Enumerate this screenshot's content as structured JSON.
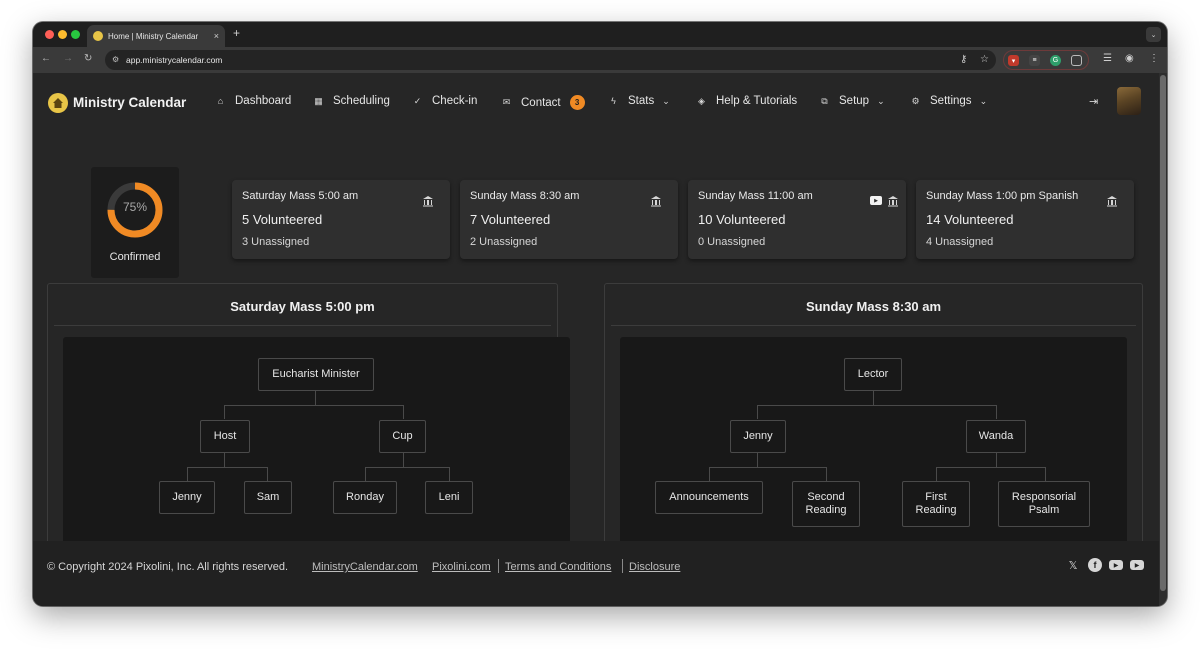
{
  "browser": {
    "tab_title": "Home | Ministry Calendar",
    "tab_close": "×",
    "new_tab": "+",
    "url": "app.ministrycalendar.com"
  },
  "app": {
    "brand": "Ministry Calendar",
    "nav": [
      {
        "label": "Dashboard",
        "icon": "home-icon"
      },
      {
        "label": "Scheduling",
        "icon": "calendar-icon"
      },
      {
        "label": "Check-in",
        "icon": "check-circle-icon"
      },
      {
        "label": "Contact",
        "icon": "envelope-icon",
        "badge": "3"
      },
      {
        "label": "Stats",
        "icon": "bolt-icon",
        "dropdown": true
      },
      {
        "label": "Help & Tutorials",
        "icon": "graduation-cap-icon"
      },
      {
        "label": "Setup",
        "icon": "sitemap-icon",
        "dropdown": true
      },
      {
        "label": "Settings",
        "icon": "gear-icon",
        "dropdown": true
      }
    ]
  },
  "summary": {
    "confirmed_percent": 75,
    "confirmed_text": "75%",
    "confirmed_label": "Confirmed"
  },
  "masses": [
    {
      "title": "Saturday Mass 5:00 am",
      "volunteered": "5 Volunteered",
      "unassigned": "3 Unassigned",
      "youtube": false
    },
    {
      "title": "Sunday Mass 8:30 am",
      "volunteered": "7 Volunteered",
      "unassigned": "2 Unassigned",
      "youtube": false
    },
    {
      "title": "Sunday Mass 11:00 am",
      "volunteered": "10 Volunteered",
      "unassigned": "0 Unassigned",
      "youtube": true
    },
    {
      "title": "Sunday Mass 1:00 pm Spanish",
      "volunteered": "14 Volunteered",
      "unassigned": "4 Unassigned",
      "youtube": false
    }
  ],
  "panels": [
    {
      "title": "Saturday Mass 5:00 pm",
      "root": "Eucharist Minister",
      "children": [
        {
          "label": "Host",
          "children": [
            "Jenny",
            "Sam"
          ]
        },
        {
          "label": "Cup",
          "children": [
            "Ronday",
            "Leni"
          ]
        }
      ]
    },
    {
      "title": "Sunday Mass 8:30 am",
      "root": "Lector",
      "children": [
        {
          "label": "Jenny",
          "children": [
            "Announcements",
            "Second Reading"
          ]
        },
        {
          "label": "Wanda",
          "children": [
            "First Reading",
            "Responsorial Psalm"
          ]
        }
      ]
    }
  ],
  "footer": {
    "copyright": "© Copyright 2024 Pixolini, Inc. All rights reserved.",
    "links": [
      "MinistryCalendar.com",
      "Pixolini.com",
      "Terms and Conditions",
      "Disclosure"
    ]
  },
  "colors": {
    "accent": "#f08a24",
    "background": "#262626",
    "card": "#2f2f2f",
    "tree_bg": "#181818"
  }
}
